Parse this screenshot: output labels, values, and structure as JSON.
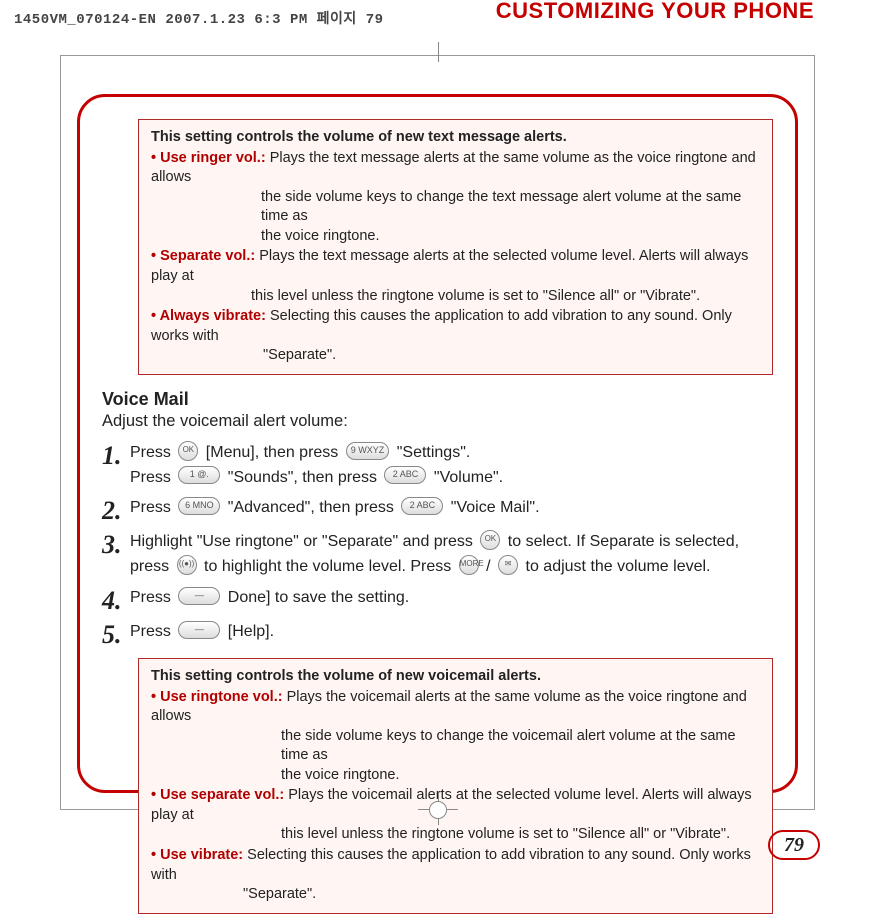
{
  "print_mark": "1450VM_070124-EN  2007.1.23 6:3 PM  페이지 79",
  "header": "CUSTOMIZING YOUR PHONE",
  "box1": {
    "title": "This setting controls the volume of new text message alerts.",
    "items": [
      {
        "label": "• Use ringer vol.:",
        "desc": " Plays the text message alerts at the same volume as the voice ringtone and allows",
        "cont1": "the side volume keys to change the text message alert volume at the same time as",
        "cont2": "the voice ringtone."
      },
      {
        "label": "• Separate vol.:",
        "desc": " Plays the text message alerts at the selected volume level.  Alerts will always play at",
        "cont1": "this level unless the ringtone volume is set to \"Silence all\" or \"Vibrate\"."
      },
      {
        "label": "• Always vibrate:",
        "desc": " Selecting this causes the application to add vibration to any sound.  Only works with",
        "cont1": "\"Separate\"."
      }
    ]
  },
  "section_title": "Voice Mail",
  "lead": "Adjust the voicemail alert volume:",
  "steps": {
    "s1a": "Press ",
    "s1b": " [Menu], then press ",
    "s1c": " \"Settings\".",
    "s1d": "Press ",
    "s1e": " \"Sounds\", then press ",
    "s1f": " \"Volume\".",
    "s2a": "Press ",
    "s2b": " \"Advanced\", then press ",
    "s2c": " \"Voice Mail\".",
    "s3a": "Highlight \"Use ringtone\" or \"Separate\" and press ",
    "s3b": " to select.  If Separate is selected,",
    "s3c": "press ",
    "s3d": " to highlight the volume level.  Press ",
    "s3e": " / ",
    "s3f": " to adjust the volume level.",
    "s4a": "Press ",
    "s4b": " Done] to save the setting.",
    "s5a": "Press ",
    "s5b": " [Help]."
  },
  "nums": {
    "n1": "1.",
    "n2": "2.",
    "n3": "3.",
    "n4": "4.",
    "n5": "5."
  },
  "keys": {
    "ok": "OK",
    "k9": "9 WXYZ",
    "k1": "1 @.",
    "k2": "2 ABC",
    "k6": "6 MNO",
    "dash": "—",
    "more": "MORE",
    "mail": "✉",
    "vib": "((●))"
  },
  "box2": {
    "title": "This setting controls the volume of new voicemail alerts.",
    "items": [
      {
        "label": "• Use ringtone vol.:",
        "desc": " Plays the voicemail alerts at the same volume as the voice ringtone and allows",
        "cont1": "the side volume keys to change the voicemail alert volume at the same time as",
        "cont2": "the voice ringtone."
      },
      {
        "label": "• Use separate vol.:",
        "desc": " Plays the voicemail alerts at the selected volume level.  Alerts will always play at",
        "cont1": "this level unless the ringtone volume is set to \"Silence all\" or \"Vibrate\"."
      },
      {
        "label": "• Use vibrate:",
        "desc": " Selecting this causes the application to add vibration to any sound.  Only works with",
        "cont1": "\"Separate\"."
      }
    ]
  },
  "page_number": "79"
}
